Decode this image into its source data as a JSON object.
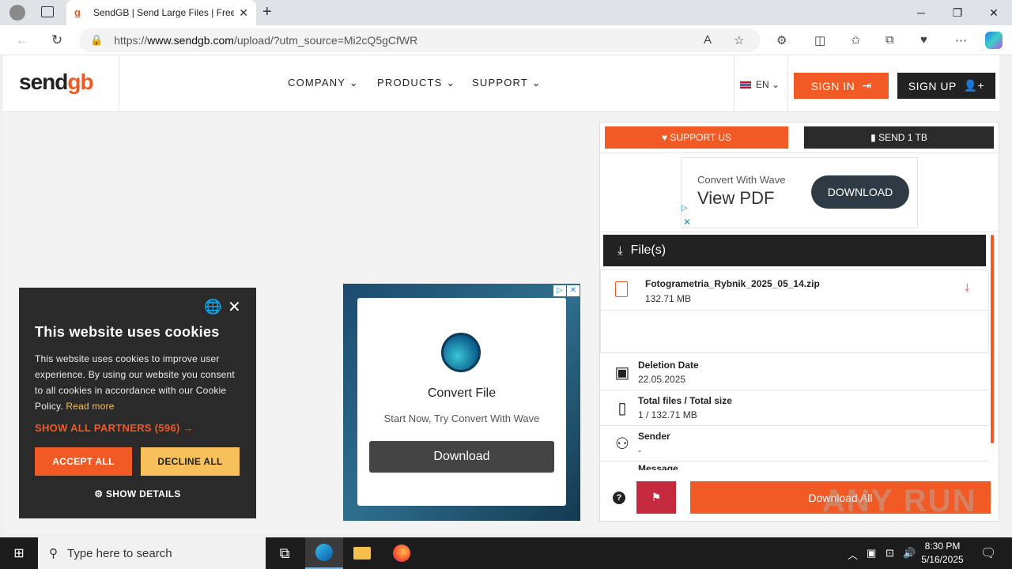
{
  "browser": {
    "tab_title": "SendGB | Send Large Files | Free f",
    "url_prefix": "https://",
    "url_domain": "www.sendgb.com",
    "url_rest": "/upload/?utm_source=Mi2cQ5gCfWR"
  },
  "site": {
    "logo_send": "send",
    "logo_gb": "gb",
    "menu": [
      "COMPANY",
      "PRODUCTS",
      "SUPPORT"
    ],
    "lang": "EN",
    "sign_in": "SIGN IN",
    "sign_up": "SIGN UP"
  },
  "panel": {
    "support_us": "SUPPORT US",
    "send_1tb": "SEND 1 TB",
    "ad": {
      "line1": "Convert With Wave",
      "line2": "View PDF",
      "button": "DOWNLOAD"
    },
    "files_header": "File(s)",
    "file": {
      "name": "Fotogrametria_Rybnik_2025_05_14.zip",
      "size": "132.71 MB"
    },
    "info": [
      {
        "label": "Deletion Date",
        "value": "22.05.2025",
        "icon": "calendar-icon"
      },
      {
        "label": "Total files / Total size",
        "value": "1 / 132.71 MB",
        "icon": "file-icon"
      },
      {
        "label": "Sender",
        "value": "-",
        "icon": "user-icon"
      },
      {
        "label": "Message",
        "value": "",
        "icon": "message-icon"
      }
    ],
    "help": "?",
    "download_all": "Download All"
  },
  "mid_ad": {
    "title": "Convert File",
    "subtitle": "Start Now, Try Convert With Wave",
    "button": "Download"
  },
  "cookie": {
    "title": "This website uses cookies",
    "body": "This website uses cookies to improve user experience. By using our website you consent to all cookies in accordance with our Cookie Policy.",
    "read_more": "Read more",
    "partners": "SHOW ALL PARTNERS (596) →",
    "accept": "ACCEPT ALL",
    "decline": "DECLINE ALL",
    "show_details": "SHOW DETAILS"
  },
  "watermark": "ANY RUN",
  "taskbar": {
    "search_placeholder": "Type here to search",
    "time": "8:30 PM",
    "date": "5/16/2025"
  }
}
